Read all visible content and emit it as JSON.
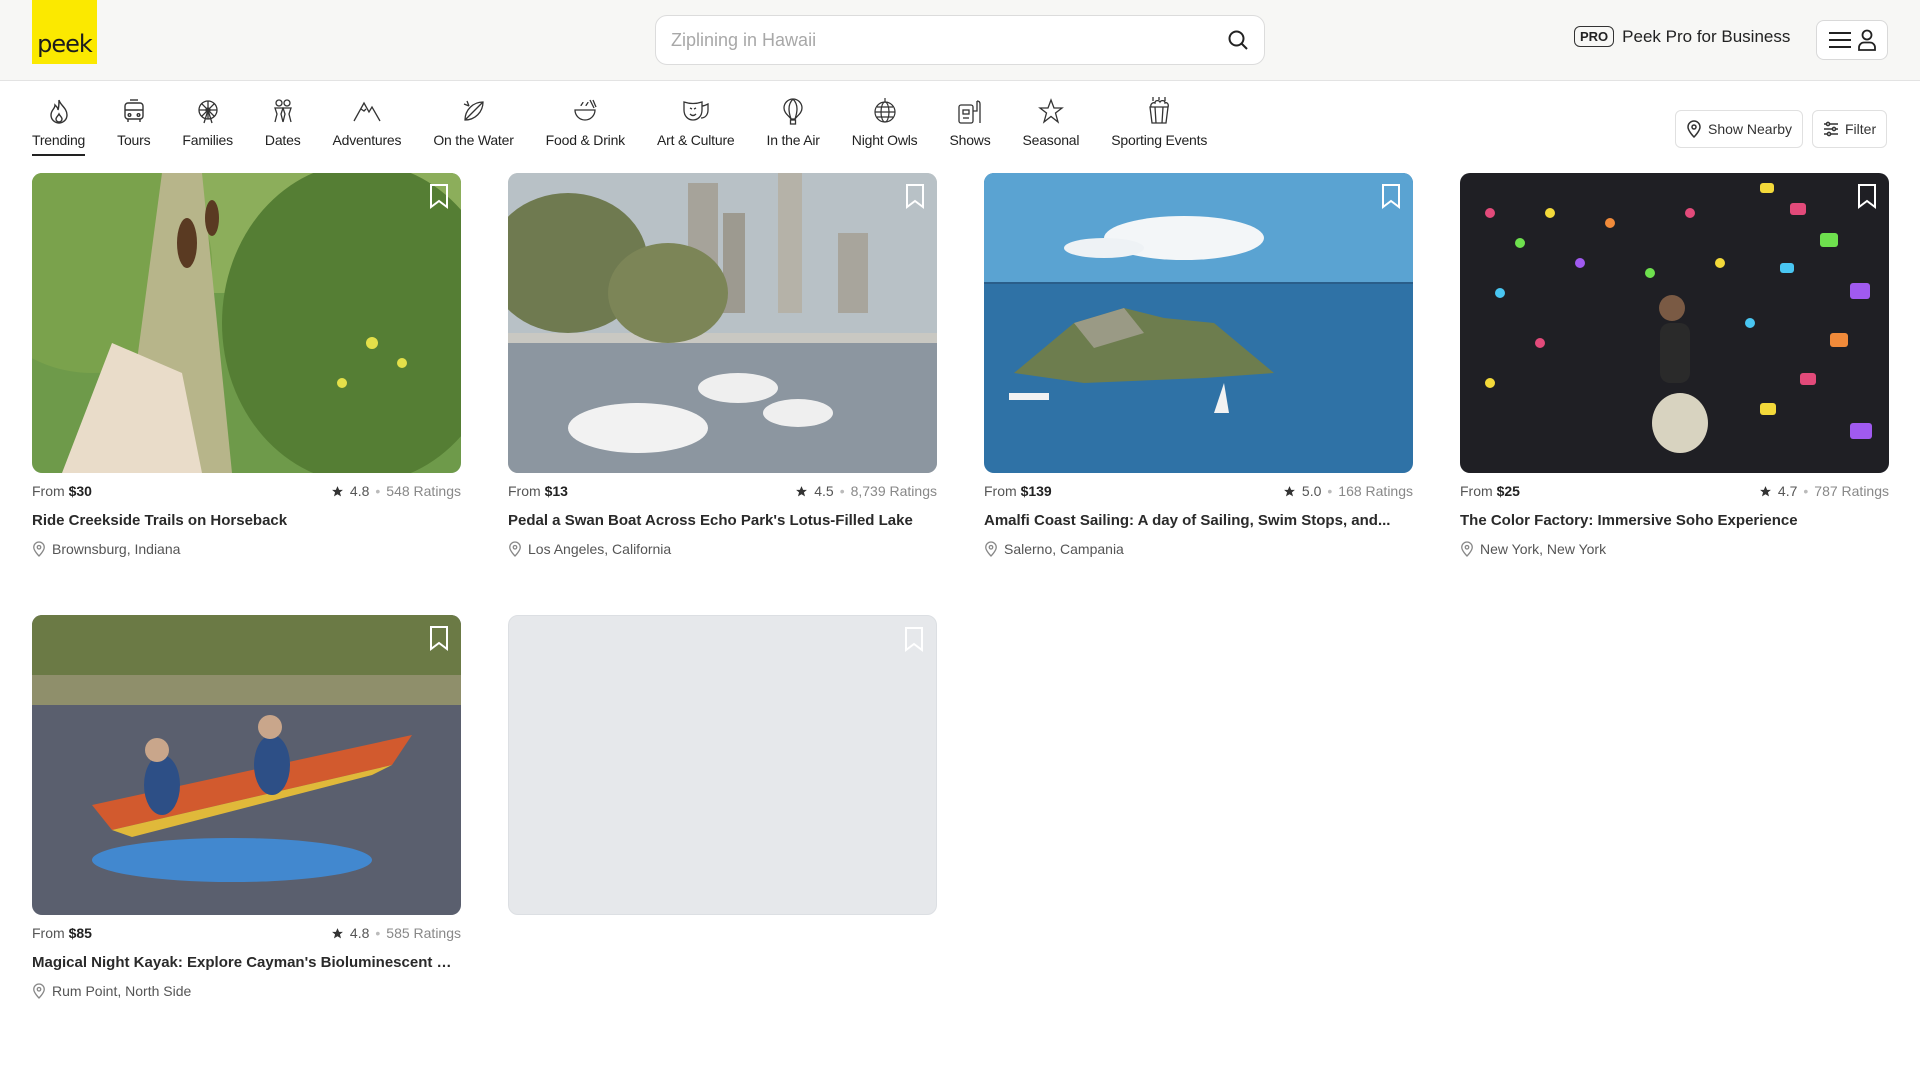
{
  "brand": {
    "logo_text": "peek",
    "logo_color": "#fbe900"
  },
  "search": {
    "placeholder": "Ziplining in Hawaii"
  },
  "header": {
    "pro_badge": "PRO",
    "pro_label": "Peek Pro for Business"
  },
  "categories": [
    {
      "label": "Trending",
      "icon": "flame-icon",
      "active": true
    },
    {
      "label": "Tours",
      "icon": "bus-icon"
    },
    {
      "label": "Families",
      "icon": "ferris-wheel-icon"
    },
    {
      "label": "Dates",
      "icon": "couple-icon"
    },
    {
      "label": "Adventures",
      "icon": "mountain-icon"
    },
    {
      "label": "On the Water",
      "icon": "surfboard-icon"
    },
    {
      "label": "Food & Drink",
      "icon": "bowl-icon"
    },
    {
      "label": "Art & Culture",
      "icon": "theater-mask-icon"
    },
    {
      "label": "In the Air",
      "icon": "hot-air-balloon-icon"
    },
    {
      "label": "Night Owls",
      "icon": "disco-ball-icon"
    },
    {
      "label": "Shows",
      "icon": "ticket-icon"
    },
    {
      "label": "Seasonal",
      "icon": "star-icon"
    },
    {
      "label": "Sporting Events",
      "icon": "popcorn-icon"
    }
  ],
  "controls": {
    "nearby_label": "Show Nearby",
    "filter_label": "Filter"
  },
  "listings": [
    {
      "from_label": "From",
      "price": "$30",
      "rating": "4.8",
      "sep": "•",
      "ratings_count": "548 Ratings",
      "title": "Ride Creekside Trails on Horseback",
      "location": "Brownsburg, Indiana"
    },
    {
      "from_label": "From",
      "price": "$13",
      "rating": "4.5",
      "sep": "•",
      "ratings_count": "8,739 Ratings",
      "title": "Pedal a Swan Boat Across Echo Park's Lotus-Filled Lake",
      "location": "Los Angeles, California"
    },
    {
      "from_label": "From",
      "price": "$139",
      "rating": "5.0",
      "sep": "•",
      "ratings_count": "168 Ratings",
      "title": "Amalfi Coast Sailing: A day of Sailing, Swim Stops, and...",
      "location": "Salerno, Campania"
    },
    {
      "from_label": "From",
      "price": "$25",
      "rating": "4.7",
      "sep": "•",
      "ratings_count": "787 Ratings",
      "title": "The Color Factory: Immersive Soho Experience",
      "location": "New York, New York"
    },
    {
      "from_label": "From",
      "price": "$85",
      "rating": "4.8",
      "sep": "•",
      "ratings_count": "585 Ratings",
      "title": "Magical Night Kayak: Explore Cayman's Bioluminescent Bay",
      "location": "Rum Point, North Side"
    }
  ]
}
